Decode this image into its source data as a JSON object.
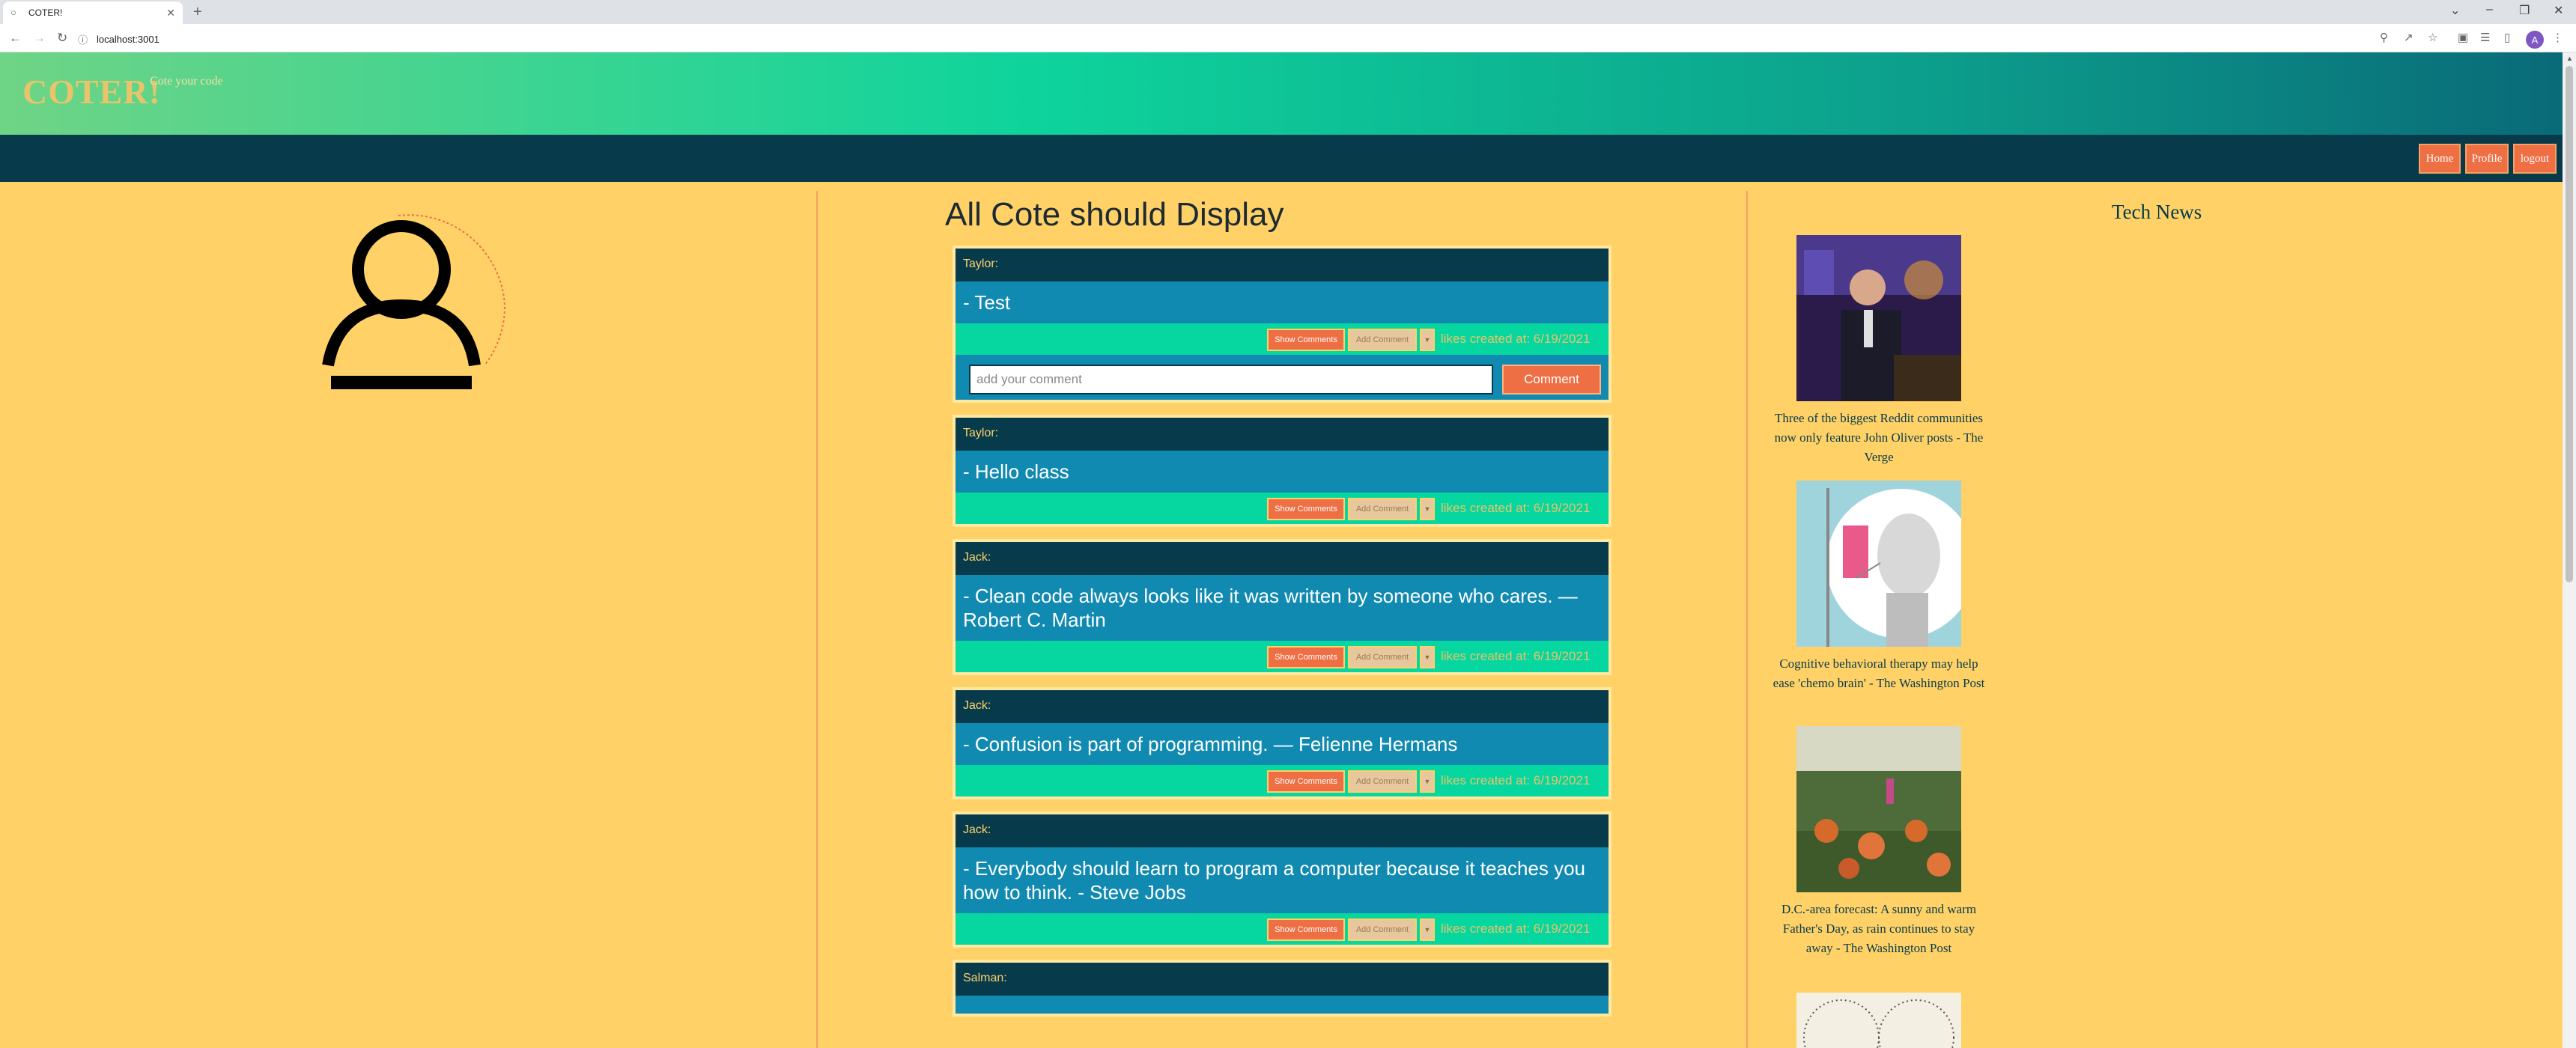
{
  "browser": {
    "tab_title": "COTER!",
    "url": "localhost:3001",
    "avatar_letter": "A"
  },
  "header": {
    "brand": "COTER!",
    "slogan": "Cote your code"
  },
  "nav": {
    "home": "Home",
    "profile": "Profile",
    "logout": "logout"
  },
  "feed": {
    "title": "All Cote should Display",
    "show_comments_label": "Show Comments",
    "add_comment_label": "Add Comment",
    "likes_label": "likes created at: 6/19/2021",
    "comment_placeholder": "add your comment",
    "comment_button": "Comment",
    "posts": [
      {
        "user": "Taylor:",
        "text": "- Test"
      },
      {
        "user": "Taylor:",
        "text": "- Hello class"
      },
      {
        "user": "Jack:",
        "text": "- Clean code always looks like it was written by someone who cares. — Robert C. Martin"
      },
      {
        "user": "Jack:",
        "text": "- Confusion is part of programming. — Felienne Hermans"
      },
      {
        "user": "Jack:",
        "text": "- Everybody should learn to program a computer because it teaches you how to think. - Steve Jobs"
      },
      {
        "user": "Salman:",
        "text": ""
      }
    ]
  },
  "news": {
    "title": "Tech News",
    "items": [
      {
        "caption": "Three of the biggest Reddit communities now only feature John Oliver posts - The Verge"
      },
      {
        "caption": "Cognitive behavioral therapy may help ease 'chemo brain' - The Washington Post"
      },
      {
        "caption": "D.C.-area forecast: A sunny and warm Father's Day, as rain continues to stay away - The Washington Post"
      }
    ]
  },
  "colors": {
    "background": "#ffd166",
    "dark": "#073b4c",
    "card": "#118ab2",
    "green": "#06d6a0",
    "accent": "#ef6f45"
  }
}
